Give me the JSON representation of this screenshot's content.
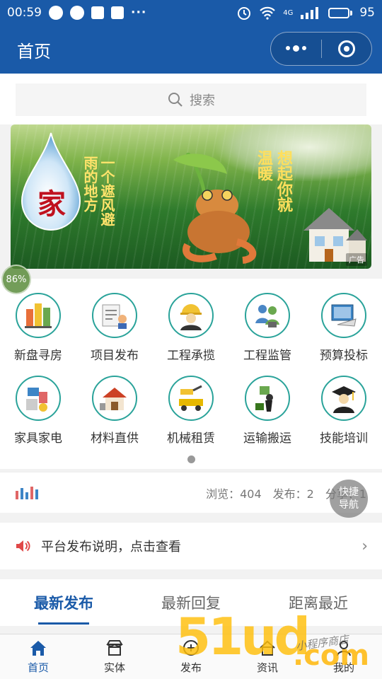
{
  "status_bar": {
    "time": "00:59",
    "more": "···",
    "network": "4G",
    "battery_level": "95"
  },
  "app_bar": {
    "title": "首页"
  },
  "search": {
    "placeholder": "搜索"
  },
  "banner": {
    "logo_text": "家",
    "slogan_left": "一个遮风避雨的地方",
    "slogan_right": "想起你就温暖",
    "ad_label": "广告"
  },
  "categories": [
    {
      "label": "新盘寻房",
      "icon": "new-homes-icon"
    },
    {
      "label": "项目发布",
      "icon": "project-publish-icon"
    },
    {
      "label": "工程承揽",
      "icon": "construction-worker-icon"
    },
    {
      "label": "工程监管",
      "icon": "engineering-supervision-icon"
    },
    {
      "label": "预算投标",
      "icon": "budget-bid-icon"
    },
    {
      "label": "家具家电",
      "icon": "furniture-appliance-icon"
    },
    {
      "label": "材料直供",
      "icon": "materials-supply-icon"
    },
    {
      "label": "机械租赁",
      "icon": "machinery-rental-icon"
    },
    {
      "label": "运输搬运",
      "icon": "transport-moving-icon"
    },
    {
      "label": "技能培训",
      "icon": "skills-training-icon"
    }
  ],
  "float_badge": "86%",
  "stats": {
    "views": "浏览：404",
    "posts": "发布：2",
    "shares": "分享：1"
  },
  "notice": {
    "text": "平台发布说明，点击查看"
  },
  "quick_nav": {
    "line1": "快捷",
    "line2": "导航"
  },
  "tabs": [
    {
      "label": "最新发布",
      "active": true
    },
    {
      "label": "最新回复",
      "active": false
    },
    {
      "label": "距离最近",
      "active": false
    }
  ],
  "bottom_nav": [
    {
      "label": "首页",
      "icon": "home-icon",
      "active": true
    },
    {
      "label": "实体",
      "icon": "store-icon",
      "active": false
    },
    {
      "label": "发布",
      "icon": "plus-circle-icon",
      "active": false
    },
    {
      "label": "资讯",
      "icon": "news-home-icon",
      "active": false
    },
    {
      "label": "我的",
      "icon": "user-icon",
      "active": false
    }
  ],
  "watermark": {
    "main": "51ud",
    "suffix": ".com",
    "handwriting": "小程序商店"
  },
  "colors": {
    "primary": "#1a5aa8",
    "teal_ring": "#2aa39a",
    "watermark": "#ffbe0a"
  }
}
